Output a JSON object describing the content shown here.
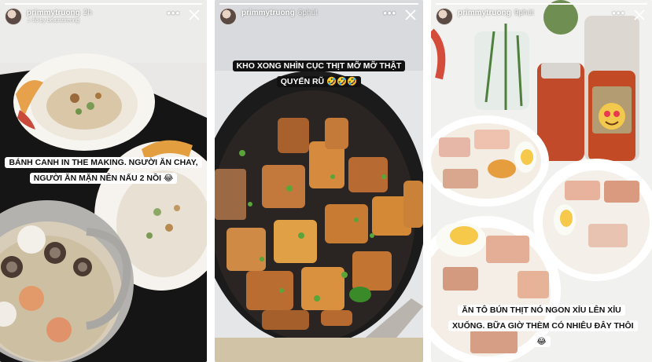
{
  "stories": [
    {
      "username": "primmytruong",
      "time": "2h",
      "sub_label": "♫ flô by beatrizfrering",
      "caption": "BÁNH CANH IN THE MAKING. NGƯỜI ĂN CHAY, NGƯỜI ĂN MẶN NÊN NẤU 2 NỒI 😂",
      "more_label": "•••",
      "close_icon": "close-icon"
    },
    {
      "username": "primmytruong",
      "time": "6phút",
      "caption": "KHO XONG NHÌN CỤC THỊT MỠ MỠ THẬT QUYẾN RŨ 🤣🤣🤣",
      "more_label": "•••",
      "close_icon": "close-icon"
    },
    {
      "username": "primmytruong",
      "time": "9phút",
      "caption": "ĂN TÔ BÚN THỊT NÓ NGON XỈU LÊN XỈU XUỐNG. BỮA GIỜ THÈM CÓ NHIÊU ĐÂY THÔI 😂",
      "more_label": "•••",
      "close_icon": "close-icon"
    }
  ],
  "colors": {
    "caption_bg": "#ffffff",
    "caption_text": "#111111",
    "dark_caption_bg": "#111111"
  }
}
